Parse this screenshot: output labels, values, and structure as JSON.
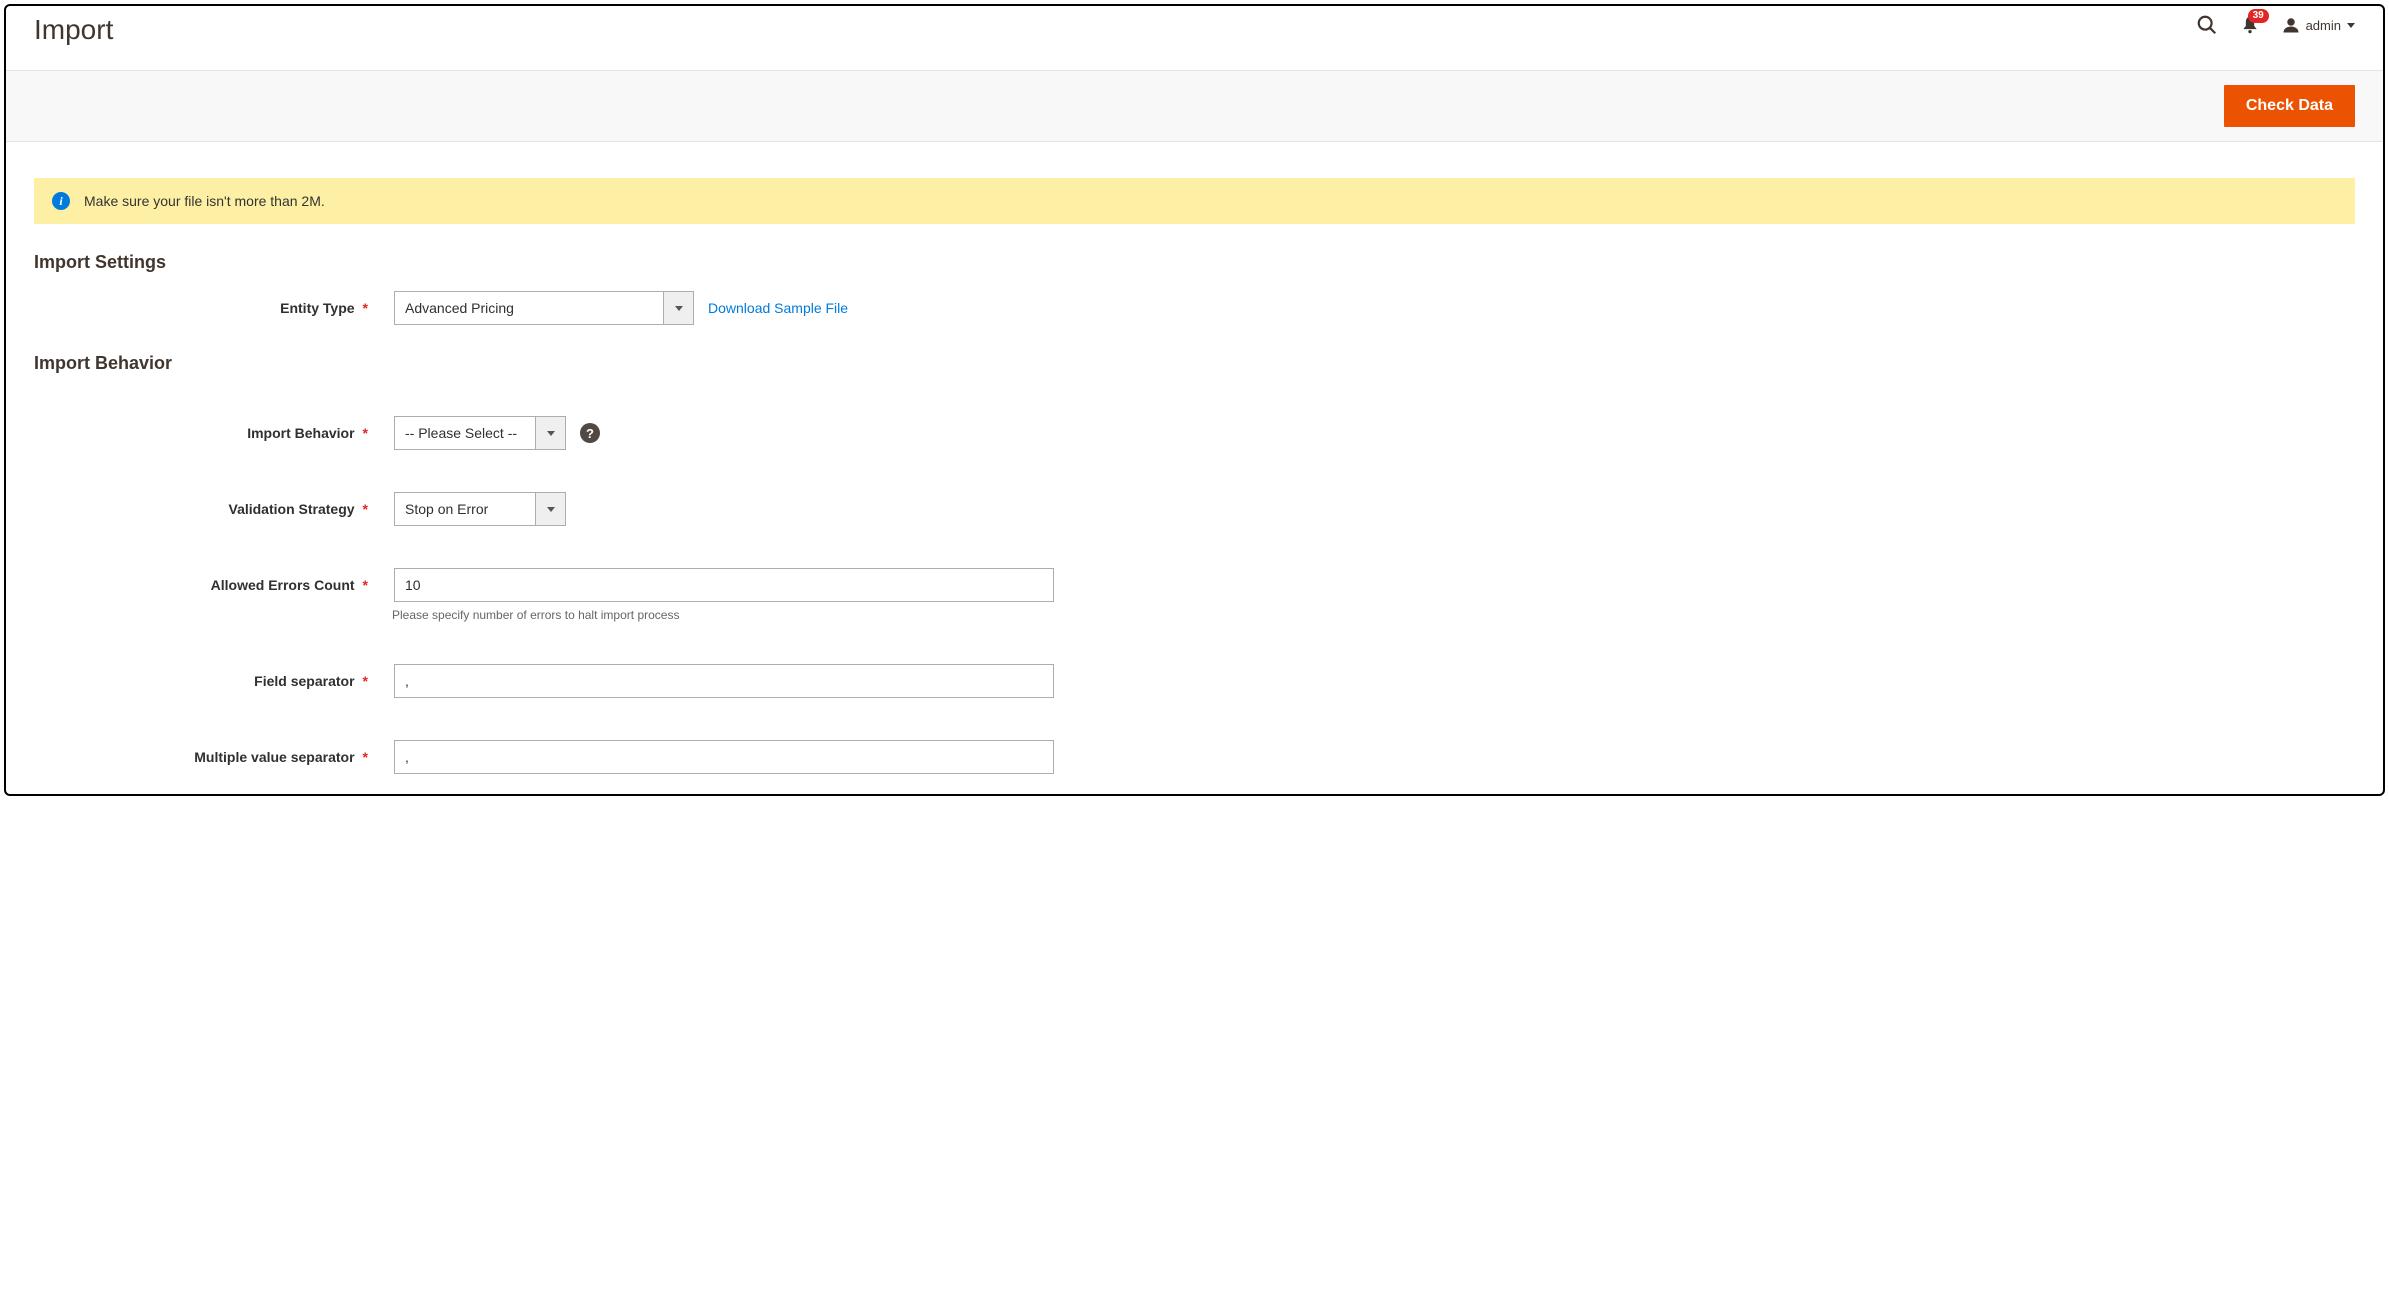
{
  "header": {
    "title": "Import",
    "notification_count": "39",
    "user_name": "admin"
  },
  "actions": {
    "check_data_label": "Check Data"
  },
  "message": {
    "text": "Make sure your file isn't more than 2M."
  },
  "sections": {
    "import_settings_title": "Import Settings",
    "import_behavior_title": "Import Behavior"
  },
  "fields": {
    "entity_type": {
      "label": "Entity Type",
      "value": "Advanced Pricing",
      "download_link": "Download Sample File"
    },
    "import_behavior": {
      "label": "Import Behavior",
      "value": "-- Please Select --"
    },
    "validation_strategy": {
      "label": "Validation Strategy",
      "value": "Stop on Error"
    },
    "allowed_errors": {
      "label": "Allowed Errors Count",
      "value": "10",
      "help": "Please specify number of errors to halt import process"
    },
    "field_separator": {
      "label": "Field separator",
      "value": ","
    },
    "multiple_value_separator": {
      "label": "Multiple value separator",
      "value": ","
    }
  }
}
